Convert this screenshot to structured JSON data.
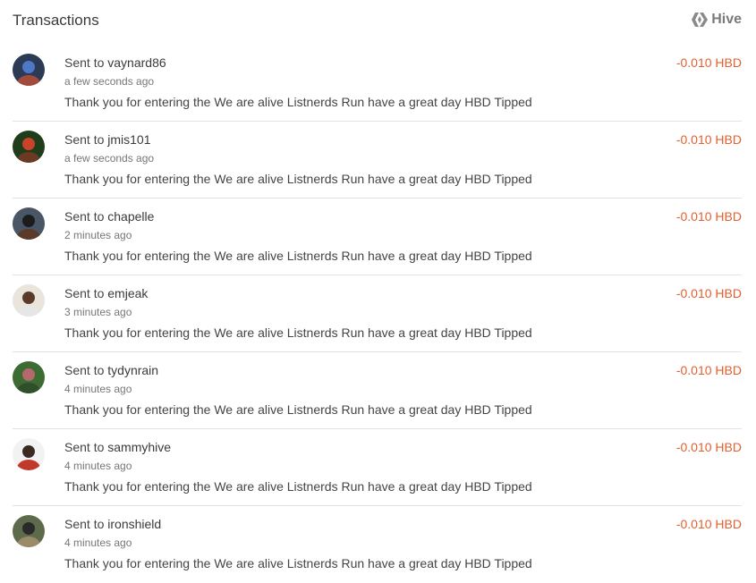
{
  "header": {
    "title": "Transactions",
    "brand_label": "Hive",
    "brand_icon": "hive-logo-icon"
  },
  "colors": {
    "amount": "#e4602e",
    "text": "#444444",
    "muted": "#777777",
    "divider": "#e2e2e2"
  },
  "transactions": [
    {
      "prefix": "Sent to",
      "user": "vaynard86",
      "time": "a few seconds ago",
      "memo": "Thank you for entering the We are alive Listnerds Run have a great day HBD Tipped",
      "amount": "-0.010 HBD",
      "avatar_colors": [
        "#2b3a55",
        "#4f78c4",
        "#a34b3a"
      ]
    },
    {
      "prefix": "Sent to",
      "user": "jmis101",
      "time": "a few seconds ago",
      "memo": "Thank you for entering the We are alive Listnerds Run have a great day HBD Tipped",
      "amount": "-0.010 HBD",
      "avatar_colors": [
        "#1f3d1a",
        "#c9432c",
        "#6b3a24"
      ]
    },
    {
      "prefix": "Sent to",
      "user": "chapelle",
      "time": "2 minutes ago",
      "memo": "Thank you for entering the We are alive Listnerds Run have a great day HBD Tipped",
      "amount": "-0.010 HBD",
      "avatar_colors": [
        "#4a5566",
        "#1c1c1c",
        "#5a3b2a"
      ]
    },
    {
      "prefix": "Sent to",
      "user": "emjeak",
      "time": "3 minutes ago",
      "memo": "Thank you for entering the We are alive Listnerds Run have a great day HBD Tipped",
      "amount": "-0.010 HBD",
      "avatar_colors": [
        "#e9e4dc",
        "#5a3b2a",
        "#e6e6e6"
      ]
    },
    {
      "prefix": "Sent to",
      "user": "tydynrain",
      "time": "4 minutes ago",
      "memo": "Thank you for entering the We are alive Listnerds Run have a great day HBD Tipped",
      "amount": "-0.010 HBD",
      "avatar_colors": [
        "#3d6b34",
        "#b46a6a",
        "#2f4f2a"
      ]
    },
    {
      "prefix": "Sent to",
      "user": "sammyhive",
      "time": "4 minutes ago",
      "memo": "Thank you for entering the We are alive Listnerds Run have a great day HBD Tipped",
      "amount": "-0.010 HBD",
      "avatar_colors": [
        "#f2f2f2",
        "#3a2a22",
        "#c0392b"
      ]
    },
    {
      "prefix": "Sent to",
      "user": "ironshield",
      "time": "4 minutes ago",
      "memo": "Thank you for entering the We are alive Listnerds Run have a great day HBD Tipped",
      "amount": "-0.010 HBD",
      "avatar_colors": [
        "#5d6b4a",
        "#2a2a2a",
        "#9c8b6a"
      ]
    }
  ]
}
